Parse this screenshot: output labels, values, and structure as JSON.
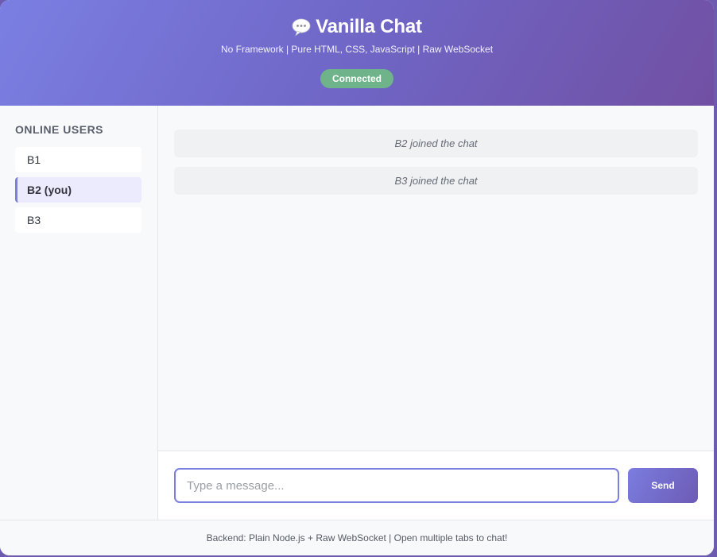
{
  "header": {
    "title": "Vanilla Chat",
    "icon": "speech-bubble-icon",
    "subtitle": "No Framework | Pure HTML, CSS, JavaScript | Raw WebSocket",
    "status": "Connected",
    "status_color": "#6fb38a",
    "gradient_colors": [
      "#7b7fe2",
      "#7150a3"
    ]
  },
  "sidebar": {
    "heading": "ONLINE USERS",
    "users": [
      {
        "label": "B1",
        "active": false
      },
      {
        "label": "B2 (you)",
        "active": true
      },
      {
        "label": "B3",
        "active": false
      }
    ]
  },
  "messages": [
    {
      "type": "system",
      "text": "B2 joined the chat"
    },
    {
      "type": "system",
      "text": "B3 joined the chat"
    }
  ],
  "composer": {
    "placeholder": "Type a message...",
    "value": "",
    "send_label": "Send",
    "accent_color": "#7c7fdf"
  },
  "footer": {
    "text": "Backend: Plain Node.js + Raw WebSocket | Open multiple tabs to chat!"
  }
}
